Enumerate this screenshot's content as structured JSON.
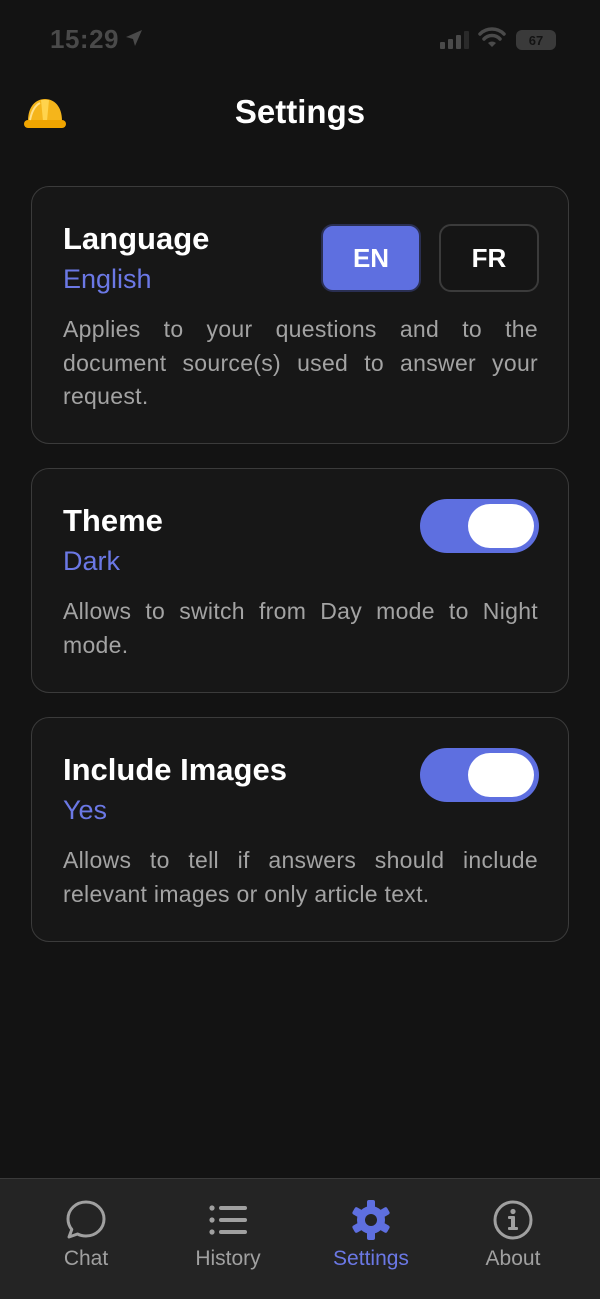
{
  "status": {
    "time": "15:29",
    "battery": "67"
  },
  "header": {
    "title": "Settings",
    "icon": "hard-hat-icon"
  },
  "language": {
    "title": "Language",
    "value": "English",
    "description": "Applies to your questions and to the document source(s) used to answer your request.",
    "options": [
      "EN",
      "FR"
    ],
    "selected": "EN"
  },
  "theme": {
    "title": "Theme",
    "value": "Dark",
    "description": "Allows to switch from Day mode to Night mode.",
    "toggle_on": true
  },
  "images": {
    "title": "Include Images",
    "value": "Yes",
    "description": "Allows to tell if answers should include relevant images or only article text.",
    "toggle_on": true
  },
  "tabs": [
    {
      "label": "Chat",
      "icon": "chat-bubble-icon",
      "active": false
    },
    {
      "label": "History",
      "icon": "list-icon",
      "active": false
    },
    {
      "label": "Settings",
      "icon": "gear-icon",
      "active": true
    },
    {
      "label": "About",
      "icon": "info-icon",
      "active": false
    }
  ],
  "colors": {
    "accent": "#5e6fe0",
    "background": "#131313",
    "card_border": "#3b3b3b",
    "text_secondary": "#a3a3a3"
  }
}
